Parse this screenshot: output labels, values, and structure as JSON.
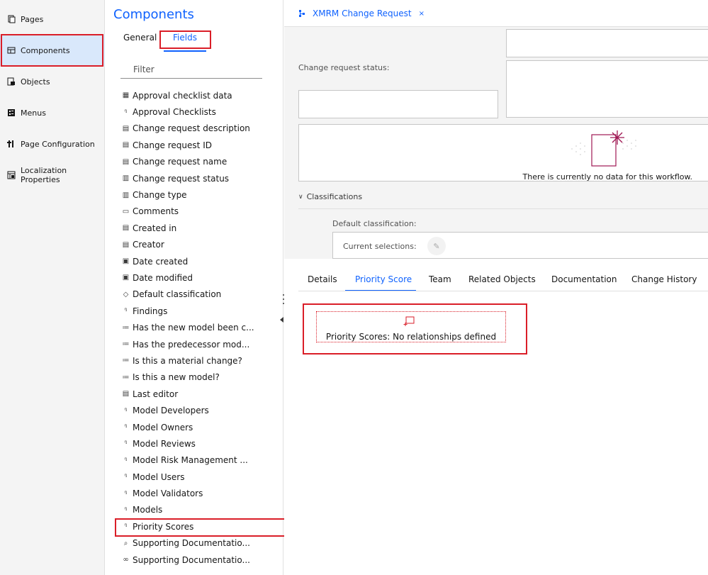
{
  "left_nav": {
    "items": [
      {
        "label": "Pages",
        "icon": "page-icon",
        "active": false
      },
      {
        "label": "Components",
        "icon": "components-icon",
        "active": true
      },
      {
        "label": "Objects",
        "icon": "objects-icon",
        "active": false
      },
      {
        "label": "Menus",
        "icon": "menus-icon",
        "active": false
      },
      {
        "label": "Page Configuration",
        "icon": "page-configuration-icon",
        "active": false
      },
      {
        "label": "Localization Properties",
        "icon": "localization-icon",
        "active": false
      }
    ]
  },
  "components_panel": {
    "title": "Components",
    "tabs": [
      {
        "label": "General",
        "selected": false
      },
      {
        "label": "Fields",
        "selected": true
      }
    ],
    "filter_placeholder": "Filter",
    "fields": [
      {
        "label": "Approval checklist data",
        "icon": "table-icon",
        "glyph": "▦"
      },
      {
        "label": "Approval Checklists",
        "icon": "relationship-icon",
        "glyph": "ᵑ"
      },
      {
        "label": "Change request description",
        "icon": "text-field-icon",
        "glyph": "▤"
      },
      {
        "label": "Change request ID",
        "icon": "text-field-icon",
        "glyph": "▤"
      },
      {
        "label": "Change request name",
        "icon": "text-field-icon",
        "glyph": "▤"
      },
      {
        "label": "Change request status",
        "icon": "select-field-icon",
        "glyph": "▥"
      },
      {
        "label": "Change type",
        "icon": "select-field-icon",
        "glyph": "▥"
      },
      {
        "label": "Comments",
        "icon": "comments-icon",
        "glyph": "▭"
      },
      {
        "label": "Created in",
        "icon": "text-field-icon",
        "glyph": "▤"
      },
      {
        "label": "Creator",
        "icon": "text-field-icon",
        "glyph": "▤"
      },
      {
        "label": "Date created",
        "icon": "calendar-icon",
        "glyph": "▣"
      },
      {
        "label": "Date modified",
        "icon": "calendar-icon",
        "glyph": "▣"
      },
      {
        "label": "Default classification",
        "icon": "tag-icon",
        "glyph": "◇"
      },
      {
        "label": "Findings",
        "icon": "relationship-icon",
        "glyph": "ᵑ"
      },
      {
        "label": "Has the new model been c...",
        "icon": "options-icon",
        "glyph": "≔"
      },
      {
        "label": "Has the predecessor mod...",
        "icon": "options-icon",
        "glyph": "≔"
      },
      {
        "label": "Is this a material change?",
        "icon": "options-icon",
        "glyph": "≔"
      },
      {
        "label": "Is this a new model?",
        "icon": "options-icon",
        "glyph": "≔"
      },
      {
        "label": "Last editor",
        "icon": "text-field-icon",
        "glyph": "▤"
      },
      {
        "label": "Model Developers",
        "icon": "relationship-icon",
        "glyph": "ᵑ"
      },
      {
        "label": "Model Owners",
        "icon": "relationship-icon",
        "glyph": "ᵑ"
      },
      {
        "label": "Model Reviews",
        "icon": "relationship-icon",
        "glyph": "ᵑ"
      },
      {
        "label": "Model Risk Management ...",
        "icon": "relationship-icon",
        "glyph": "ᵑ"
      },
      {
        "label": "Model Users",
        "icon": "relationship-icon",
        "glyph": "ᵑ"
      },
      {
        "label": "Model Validators",
        "icon": "relationship-icon",
        "glyph": "ᵑ"
      },
      {
        "label": "Models",
        "icon": "relationship-icon",
        "glyph": "ᵑ"
      },
      {
        "label": "Priority Scores",
        "icon": "relationship-icon",
        "glyph": "ᵑ"
      },
      {
        "label": "Supporting Documentatio...",
        "icon": "attachment-icon",
        "glyph": "⌕"
      },
      {
        "label": "Supporting Documentatio...",
        "icon": "link-icon",
        "glyph": "∞"
      }
    ]
  },
  "editor": {
    "doc_tab": {
      "label": "XMRM Change Request",
      "close": "×",
      "icon": "workflow-icon"
    },
    "status_label": "Change request status:",
    "workflow_message": "There is currently no data for this workflow.",
    "classifications": {
      "header": "Classifications",
      "default_label": "Default classification:",
      "current_label": "Current selections:"
    },
    "detail_tabs": [
      {
        "label": "Details",
        "selected": false
      },
      {
        "label": "Priority Score",
        "selected": true
      },
      {
        "label": "Team",
        "selected": false
      },
      {
        "label": "Related Objects",
        "selected": false
      },
      {
        "label": "Documentation",
        "selected": false
      },
      {
        "label": "Change History",
        "selected": false
      }
    ],
    "priority_message": "Priority Scores: No relationships defined"
  },
  "colors": {
    "accent": "#0f62fe",
    "highlight": "#da1e28",
    "workflow_icon": "#9f1853"
  }
}
